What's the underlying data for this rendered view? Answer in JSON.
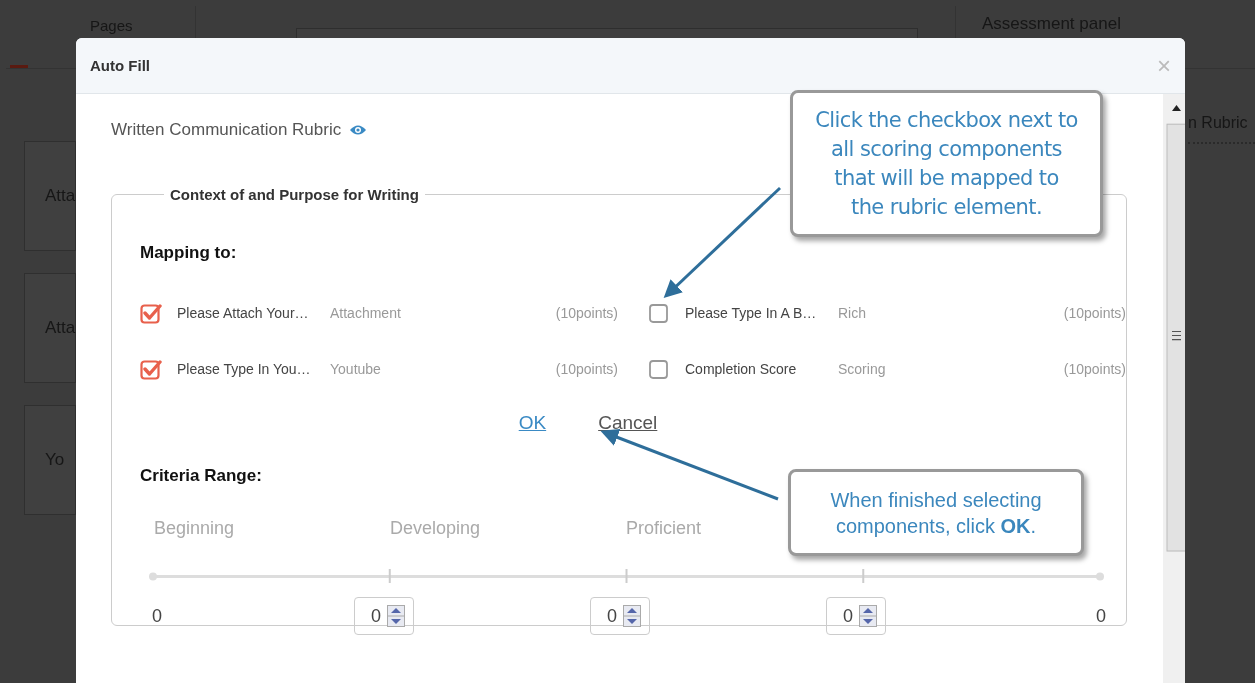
{
  "background": {
    "pages_tab": "Pages",
    "assessment_panel": "Assessment panel",
    "panel_item": "n Rubric",
    "cards": [
      "Atta",
      "Atta",
      "Yo"
    ]
  },
  "dialog": {
    "title": "Auto Fill",
    "close": "×",
    "rubric_title": "Written Communication Rubric",
    "section": {
      "legend": "Context of and Purpose for Writing",
      "mapping_title": "Mapping to:",
      "components": [
        {
          "name": "Please Attach Your…",
          "type": "Attachment",
          "points": "(10points)",
          "checked": true
        },
        {
          "name": "Please Type In A B…",
          "type": "Rich",
          "points": "(10points)",
          "checked": false
        },
        {
          "name": "Please Type In You…",
          "type": "Youtube",
          "points": "(10points)",
          "checked": true
        },
        {
          "name": "Completion Score",
          "type": "Scoring",
          "points": "(10points)",
          "checked": false
        }
      ],
      "ok": "OK",
      "cancel": "Cancel",
      "criteria_title": "Criteria Range:",
      "levels": [
        "Beginning",
        "Developing",
        "Proficient"
      ],
      "min": "0",
      "spinners": [
        "0",
        "0",
        "0"
      ],
      "max": "0"
    }
  },
  "callouts": [
    {
      "text": "Click the checkbox next to all scoring components that will be mapped to the rubric element."
    },
    {
      "text": "When finished selecting components, click **OK**."
    }
  ]
}
